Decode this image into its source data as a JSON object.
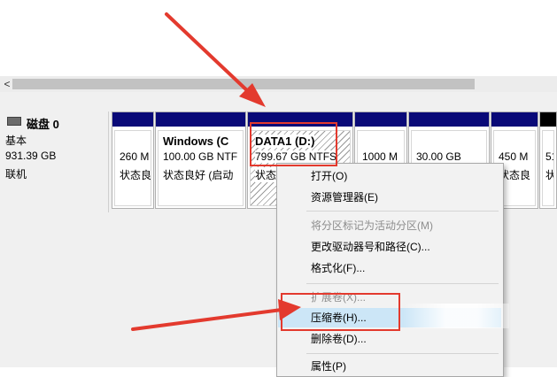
{
  "scrollbar": {
    "left_arrow": "<"
  },
  "disk": {
    "name": "磁盘 0",
    "type": "基本",
    "size": "931.39 GB",
    "status": "联机"
  },
  "partitions": [
    {
      "size": "260 M",
      "status": "状态良"
    },
    {
      "name": "Windows (C",
      "size": "100.00 GB NTF",
      "status": "状态良好 (启动"
    },
    {
      "name": "DATA1 (D:)",
      "size": "799.67 GB NTFS",
      "status": "状态"
    },
    {
      "size": "1000 M",
      "status": ""
    },
    {
      "size": "30.00 GB",
      "status": ""
    },
    {
      "size": "450 M",
      "status": "状态良"
    },
    {
      "size": "51",
      "status": "状"
    }
  ],
  "context_menu": {
    "open": "打开(O)",
    "explorer": "资源管理器(E)",
    "mark_active": "将分区标记为活动分区(M)",
    "change_letter": "更改驱动器号和路径(C)...",
    "format": "格式化(F)...",
    "extend": "扩展卷(X)...",
    "shrink": "压缩卷(H)...",
    "delete": "删除卷(D)...",
    "properties": "属性(P)"
  },
  "colors": {
    "partition_header": "#0a0a78",
    "highlight": "#cce6f7",
    "annotation_red": "#e33a2e"
  }
}
